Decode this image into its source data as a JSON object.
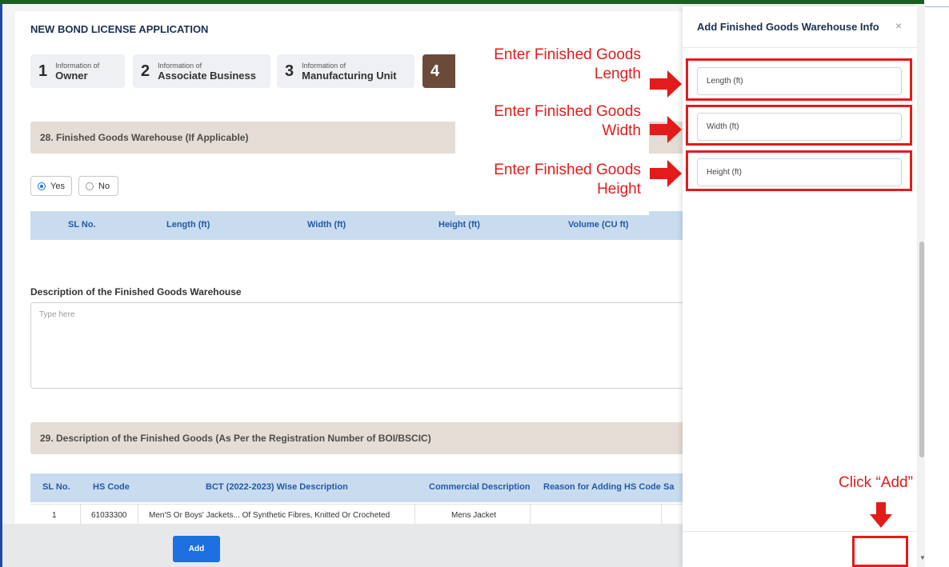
{
  "app": {
    "title": "NEW BOND LICENSE APPLICATION"
  },
  "steps": [
    {
      "num": "1",
      "small": "Information of",
      "label": "Owner"
    },
    {
      "num": "2",
      "small": "Information of",
      "label": "Associate Business"
    },
    {
      "num": "3",
      "small": "Information of",
      "label": "Manufacturing Unit"
    },
    {
      "num": "4",
      "small": "",
      "label": ""
    }
  ],
  "section28": {
    "title": "28. Finished Goods Warehouse (If Applicable)",
    "yes_label": "Yes",
    "no_label": "No",
    "columns": [
      "SL No.",
      "Length (ft)",
      "Width (ft)",
      "Height (ft)",
      "Volume (CU ft)"
    ],
    "description_label": "Description of the Finished Goods Warehouse",
    "description_placeholder": "Type here"
  },
  "section29": {
    "title": "29. Description of the Finished Goods (As Per the Registration Number of BOI/BSCIC)",
    "columns": [
      "SL No.",
      "HS Code",
      "BCT (2022-2023) Wise Description",
      "Commercial Description",
      "Reason for Adding HS Code",
      "Sa"
    ],
    "rows": [
      {
        "sl": "1",
        "hs": "61033300",
        "bct": "Men'S Or Boys' Jackets... Of Synthetic Fibres, Knitted Or Crocheted",
        "commercial": "Mens Jacket"
      }
    ]
  },
  "panel": {
    "title": "Add Finished Goods Warehouse Info",
    "close": "×",
    "length_placeholder": "Length (ft)",
    "width_placeholder": "Width (ft)",
    "height_placeholder": "Height (ft)",
    "add_label": "Add"
  },
  "annotations": {
    "length": "Enter Finished Goods Length",
    "width": "Enter Finished Goods Width",
    "height": "Enter Finished Goods Height",
    "click_add": "Click “Add”",
    "color": "#e31b1b"
  },
  "colors": {
    "primary": "#1e6fe0",
    "section_bar": "#e5ddd5",
    "table_header": "#c9dcef",
    "active_step": "#6b4a3a"
  }
}
